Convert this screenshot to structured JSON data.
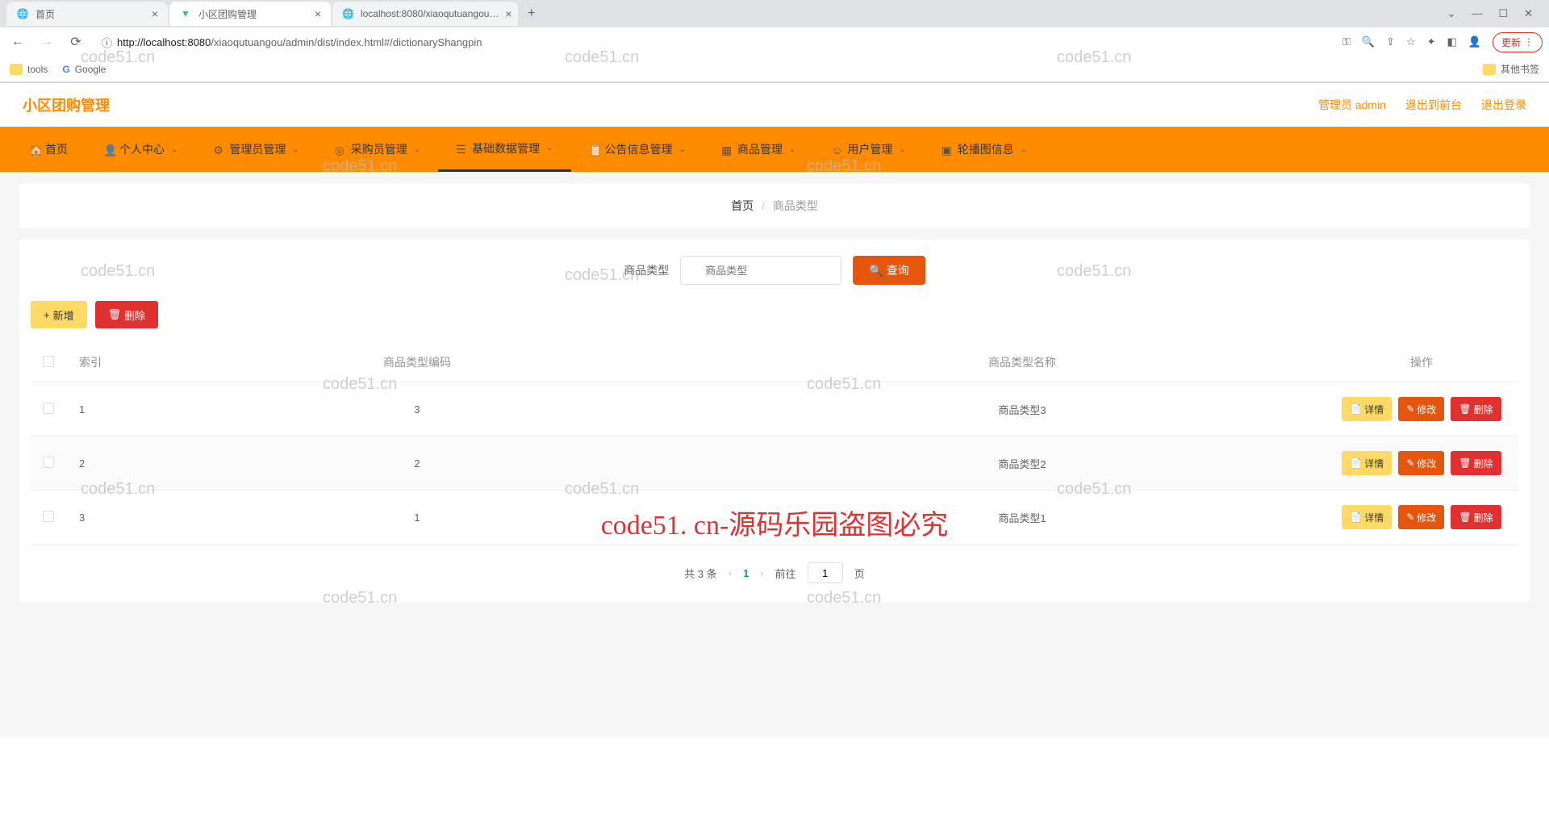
{
  "browser": {
    "tabs": [
      {
        "title": "首页",
        "active": false
      },
      {
        "title": "小区团购管理",
        "active": true
      },
      {
        "title": "localhost:8080/xiaoqutuangou…",
        "active": false
      }
    ],
    "url_host": "localhost",
    "url_port": ":8080",
    "url_path": "/xiaoqutuangou/admin/dist/index.html#/dictionaryShangpin",
    "update_label": "更新",
    "bookmarks": {
      "tools": "tools",
      "google": "Google",
      "other": "其他书签"
    }
  },
  "header": {
    "logo": "小区团购管理",
    "user": "管理员 admin",
    "exit_front": "退出到前台",
    "logout": "退出登录"
  },
  "nav": [
    {
      "label": "首页",
      "caret": false
    },
    {
      "label": "个人中心",
      "caret": true
    },
    {
      "label": "管理员管理",
      "caret": true
    },
    {
      "label": "采购员管理",
      "caret": true
    },
    {
      "label": "基础数据管理",
      "caret": true,
      "active": true
    },
    {
      "label": "公告信息管理",
      "caret": true
    },
    {
      "label": "商品管理",
      "caret": true
    },
    {
      "label": "用户管理",
      "caret": true
    },
    {
      "label": "轮播图信息",
      "caret": true
    }
  ],
  "breadcrumb": {
    "home": "首页",
    "current": "商品类型"
  },
  "search": {
    "label": "商品类型",
    "placeholder": "商品类型",
    "button": "查询"
  },
  "actions": {
    "add": "新增",
    "delete": "删除"
  },
  "table": {
    "headers": {
      "index": "索引",
      "code": "商品类型编码",
      "name": "商品类型名称",
      "ops": "操作"
    },
    "rows": [
      {
        "idx": "1",
        "code": "3",
        "name": "商品类型3"
      },
      {
        "idx": "2",
        "code": "2",
        "name": "商品类型2"
      },
      {
        "idx": "3",
        "code": "1",
        "name": "商品类型1"
      }
    ],
    "row_actions": {
      "detail": "详情",
      "edit": "修改",
      "delete": "删除"
    }
  },
  "pagination": {
    "total": "共 3 条",
    "current": "1",
    "goto_prefix": "前往",
    "goto_value": "1",
    "goto_suffix": "页"
  },
  "watermark": "code51.cn",
  "watermark_big": "code51. cn-源码乐园盗图必究"
}
